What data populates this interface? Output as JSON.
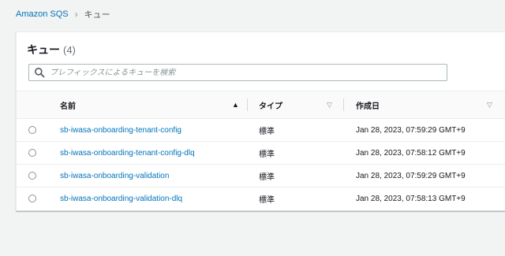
{
  "breadcrumb": {
    "service": "Amazon SQS",
    "separator": "›",
    "current": "キュー"
  },
  "panel": {
    "title": "キュー",
    "count": "(4)",
    "search": {
      "placeholder": "プレフィックスによるキューを検索",
      "value": ""
    }
  },
  "table": {
    "columns": [
      {
        "label": "名前",
        "sort": "ascending"
      },
      {
        "label": "タイプ",
        "sort": "none"
      },
      {
        "label": "作成日",
        "sort": "none"
      }
    ],
    "rows": [
      {
        "name": "sb-iwasa-onboarding-tenant-config",
        "type": "標準",
        "created": "Jan 28, 2023, 07:59:29 GMT+9"
      },
      {
        "name": "sb-iwasa-onboarding-tenant-config-dlq",
        "type": "標準",
        "created": "Jan 28, 2023, 07:58:12 GMT+9"
      },
      {
        "name": "sb-iwasa-onboarding-validation",
        "type": "標準",
        "created": "Jan 28, 2023, 07:59:29 GMT+9"
      },
      {
        "name": "sb-iwasa-onboarding-validation-dlq",
        "type": "標準",
        "created": "Jan 28, 2023, 07:58:13 GMT+9"
      }
    ]
  },
  "colors": {
    "link": "#0073bb",
    "text": "#16191f",
    "background": "#f2f3f3",
    "muted": "#687078"
  }
}
